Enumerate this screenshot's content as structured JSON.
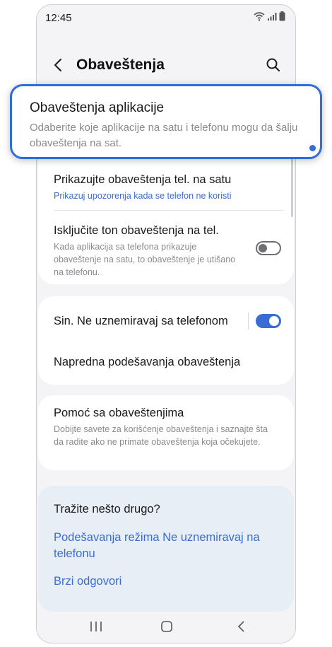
{
  "status_bar": {
    "time": "12:45"
  },
  "header": {
    "title": "Obaveštenja"
  },
  "callout": {
    "title": "Obaveštenja aplikacije",
    "subtitle": "Odaberite koje aplikacije na satu i telefonu mogu da šalju obaveštenja na sat."
  },
  "settings": {
    "show_phone_notifications": {
      "title": "Prikazujte obaveštenja tel. na satu",
      "subtitle": "Prikazuj upozorenja kada se telefon ne koristi"
    },
    "mute_phone_notifications": {
      "title": "Isključite ton obaveštenja na tel.",
      "subtitle": "Kada aplikacija sa telefona prikazuje obaveštenje na satu, to obaveštenje je utišano na telefonu.",
      "enabled": false
    },
    "sync_dnd": {
      "title": "Sin. Ne uznemiravaj sa telefonom",
      "enabled": true
    },
    "advanced": {
      "title": "Napredna podešavanja obaveštenja"
    },
    "help": {
      "title": "Pomoć sa obaveštenjima",
      "subtitle": "Dobijte savete za korišćenje obaveštenja i saznajte šta da radite ako ne primate obaveštenja koja očekujete."
    }
  },
  "suggestions": {
    "title": "Tražite nešto drugo?",
    "links": [
      "Podešavanja režima Ne uznemiravaj na telefonu",
      "Brzi odgovori"
    ]
  },
  "colors": {
    "accent": "#3a6cd4",
    "callout_border": "#2f6ce0",
    "background": "#f4f4f7"
  }
}
